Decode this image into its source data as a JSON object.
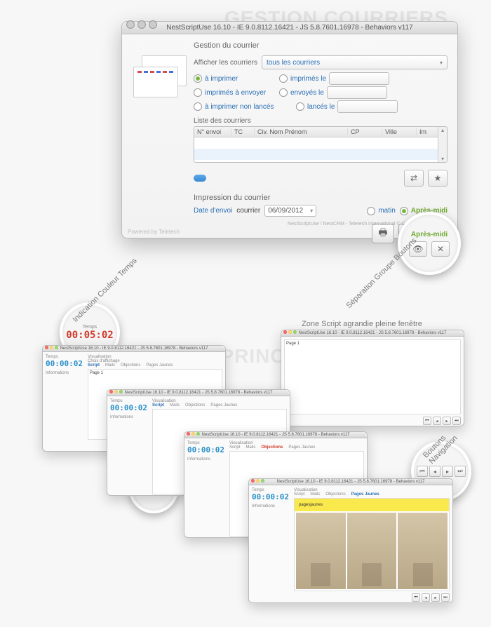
{
  "titles": {
    "section1": "GESTION COURRIERS",
    "section2": "FENÊTRE PRINCIPALE"
  },
  "annotations": {
    "separation": "Séparation Groupe Boutons",
    "timeColor": "Indication Couleur Temps",
    "zoneScript": "Zone Script agrandie pleine fenêtre",
    "navButtons": "Boutons Navigation"
  },
  "dialog": {
    "title": "NestScriptUse 16.10 - IE 9.0.8112.16421 - JS 5.8.7601.16978 - Behaviors v117",
    "mainHeading": "Gestion du courrier",
    "showLabel": "Afficher les courriers",
    "showValue": "tous les courriers",
    "radios": {
      "r1": "à imprimer",
      "r2": "imprimés le",
      "r3": "imprimés à envoyer",
      "r4": "envoyés le",
      "r5": "à imprimer non lancés",
      "r6": "lancés le"
    },
    "listLabel": "Liste des courriers",
    "columns": {
      "c1": "N° envoi",
      "c2": "TC",
      "c3": "Civ. Nom Prénom",
      "c4": "CP",
      "c5": "Ville",
      "c6": "Im"
    },
    "impressionHeading": "Impression du courrier",
    "dateLabel": "Date d'envoi",
    "dateSuffix": "courrier",
    "dateValue": "06/09/2012",
    "matin": "matin",
    "apresmidi": "Après-midi",
    "powered": "Powered by Teletech",
    "copyright": "NestScriptUse / NestCRM - Teletech International © Copyright 1993-2012"
  },
  "callout1": {
    "badge": "Après-midi"
  },
  "callout2": {
    "time": "00:05:02",
    "sub": "Temps"
  },
  "miniWindow": {
    "title": "NestScriptUse 16.10 - IE 9.0.8112.16421 - JS 5.8.7601.16978 - Behaviors v117",
    "timeLabel": "Temps",
    "timeValue": "00:00:02",
    "info": "Informations",
    "vis": "Visualisation",
    "choix": "Choix d'affichage",
    "tabs": {
      "script": "Script",
      "mails": "Mails",
      "objections": "Objections",
      "pages": "Pages Jaunes"
    },
    "page1": "Page 1"
  }
}
